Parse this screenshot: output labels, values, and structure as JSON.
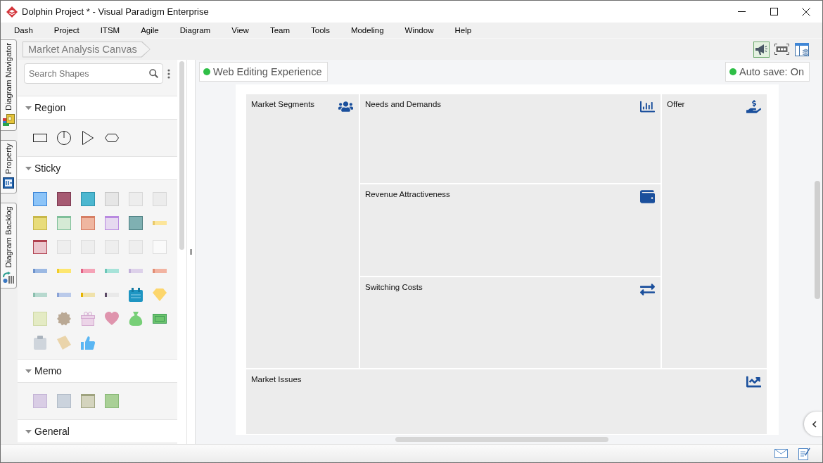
{
  "window": {
    "title": "Dolphin Project * - Visual Paradigm Enterprise"
  },
  "menu": [
    "Dash",
    "Project",
    "ITSM",
    "Agile",
    "Diagram",
    "View",
    "Team",
    "Tools",
    "Modeling",
    "Window",
    "Help"
  ],
  "side_tabs": [
    {
      "label": "Diagram Navigator",
      "kind": "navigator"
    },
    {
      "label": "Property",
      "kind": "property"
    },
    {
      "label": "Diagram Backlog",
      "kind": "backlog"
    }
  ],
  "breadcrumb": "Market Analysis Canvas",
  "view_tools": [
    {
      "kind": "megaphone",
      "selected": true
    },
    {
      "kind": "fit",
      "selected": false
    },
    {
      "kind": "panel",
      "selected": false
    }
  ],
  "palette": {
    "search": {
      "placeholder": "Search Shapes"
    },
    "sections": [
      {
        "title": "Region",
        "kind": "region"
      },
      {
        "title": "Sticky",
        "kind": "sticky"
      },
      {
        "title": "Memo",
        "kind": "memo"
      },
      {
        "title": "General",
        "kind": "general"
      }
    ]
  },
  "canvas": {
    "badges": [
      {
        "label": "Web Editing Experience",
        "on": true
      },
      {
        "label": "Auto save: On",
        "on": true
      }
    ],
    "cells": [
      {
        "title": "Market Segments",
        "kind": "segments"
      },
      {
        "title": "Needs and Demands",
        "kind": "needs"
      },
      {
        "title": "Offer",
        "kind": "offer"
      },
      {
        "title": "Revenue Attractiveness",
        "kind": "revenue"
      },
      {
        "title": "Switching Costs",
        "kind": "switching"
      },
      {
        "title": "Market Issues",
        "kind": "issues"
      }
    ]
  }
}
